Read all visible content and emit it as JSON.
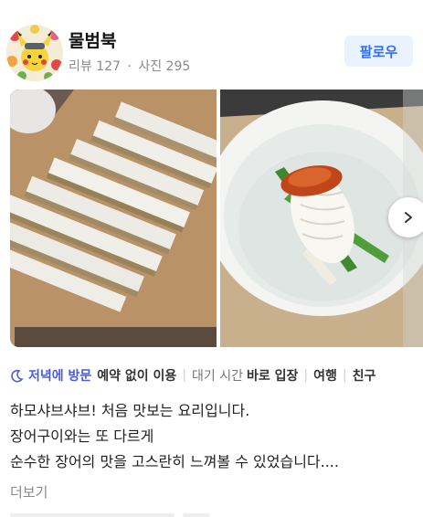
{
  "user": {
    "name": "물범북",
    "review_label": "리뷰",
    "review_count": "127",
    "separator": "·",
    "photo_label": "사진",
    "photo_count": "295",
    "follow_label": "팔로우",
    "avatar_icon": "pikachu-flower-avatar"
  },
  "photos": {
    "items": [
      {
        "name": "eel-sashimi-photo",
        "description": "sliced eel on wooden board"
      },
      {
        "name": "shabu-eel-bowl-photo",
        "description": "eel with chives and sauce in white bowl"
      }
    ],
    "next_icon": "chevron-right-icon"
  },
  "tags": {
    "time_icon": "moon-icon",
    "visit_time": "저녁에 방문",
    "reservation": "예약 없이 이용",
    "wait_label": "대기 시간",
    "wait_value": "바로 입장",
    "purpose": "여행",
    "companion": "친구",
    "separator": "|"
  },
  "review": {
    "lines": [
      "하모샤브샤브! 처음 맛보는 요리입니다.",
      "장어구이와는 또 다르게",
      "순수한 장어의 맛을 고스란히 느껴볼 수 있었습니다...."
    ],
    "more_label": "더보기"
  },
  "colors": {
    "accent_blue": "#2d6ef7",
    "follow_bg": "#eaf2fe",
    "tag_accent": "#4a5cd6",
    "muted": "#8a8a8a"
  }
}
